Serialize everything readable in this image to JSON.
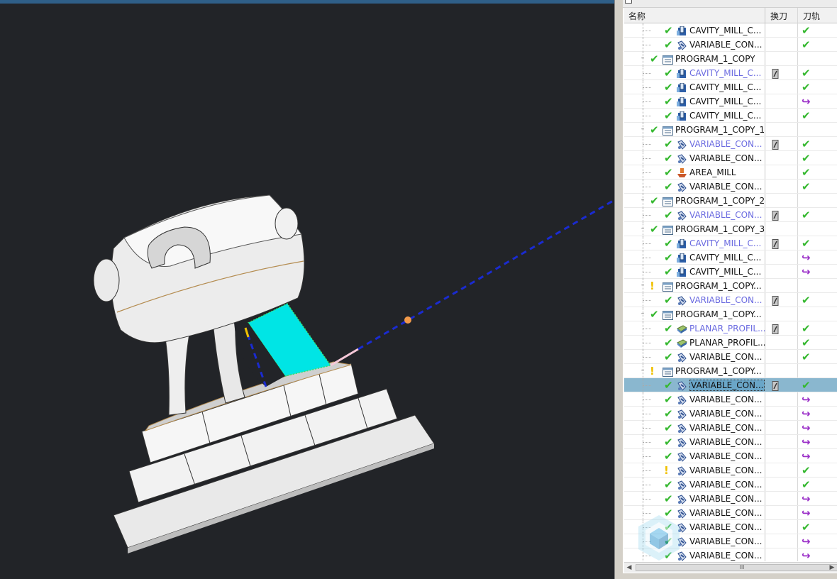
{
  "viewport": {
    "background": "#222428",
    "model": "part-model",
    "colors": {
      "body": "#eeeeee",
      "cut_region": "#00e5e5",
      "axis": "#1a2bd0",
      "point": "#f29a4a"
    }
  },
  "operation_navigator": {
    "columns": {
      "name": "名称",
      "tool_change": "换刀",
      "path": "刀轨"
    },
    "rows": [
      {
        "level": 2,
        "status": "ok",
        "icon": "cavity-mill-icon",
        "label": "CAVITY_MILL_C...",
        "blue": false,
        "tool": false,
        "path": "ok"
      },
      {
        "level": 2,
        "status": "ok",
        "icon": "variable-contour-icon",
        "label": "VARIABLE_CON...",
        "blue": false,
        "tool": false,
        "path": "ok"
      },
      {
        "level": 1,
        "status": "ok",
        "icon": "program-icon",
        "label": "PROGRAM_1_COPY",
        "blue": false,
        "tool": false,
        "path": "",
        "expander": true
      },
      {
        "level": 2,
        "status": "ok",
        "icon": "cavity-mill-icon",
        "label": "CAVITY_MILL_C...",
        "blue": true,
        "tool": true,
        "path": "ok"
      },
      {
        "level": 2,
        "status": "ok",
        "icon": "cavity-mill-icon",
        "label": "CAVITY_MILL_C...",
        "blue": false,
        "tool": false,
        "path": "ok"
      },
      {
        "level": 2,
        "status": "ok",
        "icon": "cavity-mill-icon",
        "label": "CAVITY_MILL_C...",
        "blue": false,
        "tool": false,
        "path": "regen"
      },
      {
        "level": 2,
        "status": "ok",
        "icon": "cavity-mill-icon",
        "label": "CAVITY_MILL_C...",
        "blue": false,
        "tool": false,
        "path": "ok"
      },
      {
        "level": 1,
        "status": "ok",
        "icon": "program-icon",
        "label": "PROGRAM_1_COPY_1",
        "blue": false,
        "tool": false,
        "path": "",
        "expander": true
      },
      {
        "level": 2,
        "status": "ok",
        "icon": "variable-contour-icon",
        "label": "VARIABLE_CON...",
        "blue": true,
        "tool": true,
        "path": "ok"
      },
      {
        "level": 2,
        "status": "ok",
        "icon": "variable-contour-icon",
        "label": "VARIABLE_CON...",
        "blue": false,
        "tool": false,
        "path": "ok"
      },
      {
        "level": 2,
        "status": "ok",
        "icon": "area-mill-icon",
        "label": "AREA_MILL",
        "blue": false,
        "tool": false,
        "path": "ok"
      },
      {
        "level": 2,
        "status": "ok",
        "icon": "variable-contour-icon",
        "label": "VARIABLE_CON...",
        "blue": false,
        "tool": false,
        "path": "ok"
      },
      {
        "level": 1,
        "status": "ok",
        "icon": "program-icon",
        "label": "PROGRAM_1_COPY_2",
        "blue": false,
        "tool": false,
        "path": "",
        "expander": true
      },
      {
        "level": 2,
        "status": "ok",
        "icon": "variable-contour-icon",
        "label": "VARIABLE_CON...",
        "blue": true,
        "tool": true,
        "path": "ok"
      },
      {
        "level": 1,
        "status": "ok",
        "icon": "program-icon",
        "label": "PROGRAM_1_COPY_3",
        "blue": false,
        "tool": false,
        "path": "",
        "expander": true
      },
      {
        "level": 2,
        "status": "ok",
        "icon": "cavity-mill-icon",
        "label": "CAVITY_MILL_C...",
        "blue": true,
        "tool": true,
        "path": "ok"
      },
      {
        "level": 2,
        "status": "ok",
        "icon": "cavity-mill-icon",
        "label": "CAVITY_MILL_C...",
        "blue": false,
        "tool": false,
        "path": "regen"
      },
      {
        "level": 2,
        "status": "ok",
        "icon": "cavity-mill-icon",
        "label": "CAVITY_MILL_C...",
        "blue": false,
        "tool": false,
        "path": "regen"
      },
      {
        "level": 1,
        "status": "warn",
        "icon": "program-icon",
        "label": "PROGRAM_1_COPY...",
        "blue": false,
        "tool": false,
        "path": "",
        "expander": true
      },
      {
        "level": 2,
        "status": "ok",
        "icon": "variable-contour-icon",
        "label": "VARIABLE_CON...",
        "blue": true,
        "tool": true,
        "path": "ok"
      },
      {
        "level": 1,
        "status": "ok",
        "icon": "program-icon",
        "label": "PROGRAM_1_COPY...",
        "blue": false,
        "tool": false,
        "path": "",
        "expander": true
      },
      {
        "level": 2,
        "status": "ok",
        "icon": "planar-profile-icon",
        "label": "PLANAR_PROFIL...",
        "blue": true,
        "tool": true,
        "path": "ok"
      },
      {
        "level": 2,
        "status": "ok",
        "icon": "planar-profile-icon",
        "label": "PLANAR_PROFIL...",
        "blue": false,
        "tool": false,
        "path": "ok"
      },
      {
        "level": 2,
        "status": "ok",
        "icon": "variable-contour-icon",
        "label": "VARIABLE_CON...",
        "blue": false,
        "tool": false,
        "path": "ok"
      },
      {
        "level": 1,
        "status": "warn",
        "icon": "program-icon",
        "label": "PROGRAM_1_COPY...",
        "blue": false,
        "tool": false,
        "path": "",
        "expander": true
      },
      {
        "level": 2,
        "status": "ok",
        "icon": "variable-contour-icon",
        "label": "VARIABLE_CON...",
        "blue": false,
        "tool": true,
        "path": "ok",
        "selected": true
      },
      {
        "level": 2,
        "status": "ok",
        "icon": "variable-contour-icon",
        "label": "VARIABLE_CON...",
        "blue": false,
        "tool": false,
        "path": "regen"
      },
      {
        "level": 2,
        "status": "ok",
        "icon": "variable-contour-icon",
        "label": "VARIABLE_CON...",
        "blue": false,
        "tool": false,
        "path": "regen"
      },
      {
        "level": 2,
        "status": "ok",
        "icon": "variable-contour-icon",
        "label": "VARIABLE_CON...",
        "blue": false,
        "tool": false,
        "path": "regen"
      },
      {
        "level": 2,
        "status": "ok",
        "icon": "variable-contour-icon",
        "label": "VARIABLE_CON...",
        "blue": false,
        "tool": false,
        "path": "regen"
      },
      {
        "level": 2,
        "status": "ok",
        "icon": "variable-contour-icon",
        "label": "VARIABLE_CON...",
        "blue": false,
        "tool": false,
        "path": "regen"
      },
      {
        "level": 2,
        "status": "warn",
        "icon": "variable-contour-icon",
        "label": "VARIABLE_CON...",
        "blue": false,
        "tool": false,
        "path": "ok"
      },
      {
        "level": 2,
        "status": "ok",
        "icon": "variable-contour-icon",
        "label": "VARIABLE_CON...",
        "blue": false,
        "tool": false,
        "path": "ok"
      },
      {
        "level": 2,
        "status": "ok",
        "icon": "variable-contour-icon",
        "label": "VARIABLE_CON...",
        "blue": false,
        "tool": false,
        "path": "regen"
      },
      {
        "level": 2,
        "status": "ok",
        "icon": "variable-contour-icon",
        "label": "VARIABLE_CON...",
        "blue": false,
        "tool": false,
        "path": "regen"
      },
      {
        "level": 2,
        "status": "ok",
        "icon": "variable-contour-icon",
        "label": "VARIABLE_CON...",
        "blue": false,
        "tool": false,
        "path": "ok"
      },
      {
        "level": 2,
        "status": "ok",
        "icon": "variable-contour-icon",
        "label": "VARIABLE_CON...",
        "blue": false,
        "tool": false,
        "path": "regen"
      },
      {
        "level": 2,
        "status": "ok",
        "icon": "variable-contour-icon",
        "label": "VARIABLE_CON...",
        "blue": false,
        "tool": false,
        "path": "regen"
      }
    ],
    "scrollbar": {
      "grip": "III"
    }
  }
}
